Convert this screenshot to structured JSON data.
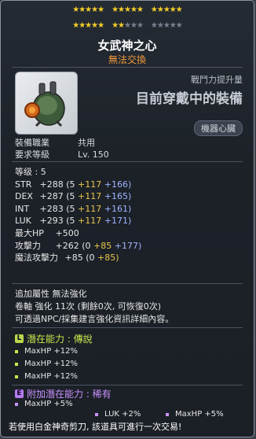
{
  "stars": {
    "row1": [
      5,
      5,
      5
    ],
    "row2_filled": [
      5,
      2,
      0
    ],
    "row2_total": [
      5,
      5,
      5
    ]
  },
  "item": {
    "name": "女武神之心",
    "untradable": "無法交換",
    "icon": "machine-heart-icon",
    "power_label": "戰鬥力提升量",
    "current_equip_label": "目前穿戴中的裝備",
    "part_badge": "機器心臟"
  },
  "requirements": [
    {
      "label": "裝備職業",
      "value": "共用"
    },
    {
      "label": "要求等級",
      "value": "Lv. 150"
    }
  ],
  "level": "等级 : 5",
  "main_stats": [
    {
      "name": "STR",
      "total": "+288",
      "base": "(5",
      "add": "+117",
      "star": "+166)"
    },
    {
      "name": "DEX",
      "total": "+287",
      "base": "(5",
      "add": "+117",
      "star": "+165)"
    },
    {
      "name": "INT",
      "total": "+283",
      "base": "(5",
      "add": "+117",
      "star": "+161)"
    },
    {
      "name": "LUK",
      "total": "+293",
      "base": "(5",
      "add": "+117",
      "star": "+171)"
    }
  ],
  "maxhp": {
    "label": "最大HP",
    "value": "+500"
  },
  "attack": {
    "label": "攻擊力",
    "total": "+262",
    "base": "(0",
    "add": "+85",
    "star": "+177)"
  },
  "magic": {
    "label": "魔法攻擊力",
    "total": "+85",
    "base": "(0",
    "add": "+85)"
  },
  "extra": {
    "attr": "追加屬性 無法強化",
    "scroll": "卷軸 強化 11次 (剩餘0次, 可恢復0次)",
    "note": "可透過NPC/採集建言強化資訊詳細內容。"
  },
  "potential": {
    "header": "潛在能力 : 傳說",
    "icon": "L",
    "color": "#c9e84b",
    "lines": [
      "MaxHP +12%",
      "MaxHP +12%",
      "MaxHP +12%"
    ]
  },
  "bonus_potential": {
    "header": "附加潛在能力 : 稀有",
    "icon": "E",
    "color": "#c892ff",
    "lines": [
      "MaxHP +5%",
      "LUK +2%",
      "MaxHP +5%"
    ]
  },
  "footer": "若使用白金神奇剪刀, 該道具可進行一次交易!"
}
